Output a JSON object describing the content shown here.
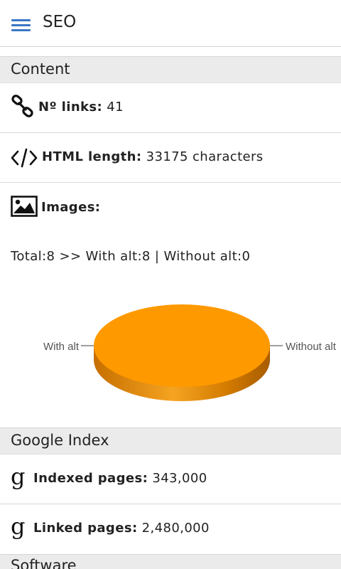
{
  "appbar": {
    "title": "SEO",
    "menu_icon": "hamburger-menu-icon",
    "accent": "#3a77c4"
  },
  "sections": {
    "content": {
      "title": "Content"
    },
    "google_index": {
      "title": "Google Index"
    },
    "software": {
      "title": "Software"
    }
  },
  "content": {
    "links": {
      "icon": "link-icon",
      "label": "Nº links:",
      "value": "41"
    },
    "html_length": {
      "icon": "code-icon",
      "label": "HTML length:",
      "value": "33175 characters"
    },
    "images": {
      "icon": "image-icon",
      "label": "Images:",
      "summary": "Total:8 >> With alt:8 | Without alt:0"
    }
  },
  "google": {
    "indexed": {
      "icon": "google-g-icon",
      "label": "Indexed pages:",
      "value": "343,000"
    },
    "linked": {
      "icon": "google-g-icon",
      "label": "Linked pages:",
      "value": "2,480,000"
    }
  },
  "chart_data": {
    "type": "pie",
    "style": "3d",
    "categories": [
      "With alt",
      "Without alt"
    ],
    "values": [
      8,
      0
    ],
    "colors": [
      "#ff9900",
      "#3366cc"
    ]
  }
}
